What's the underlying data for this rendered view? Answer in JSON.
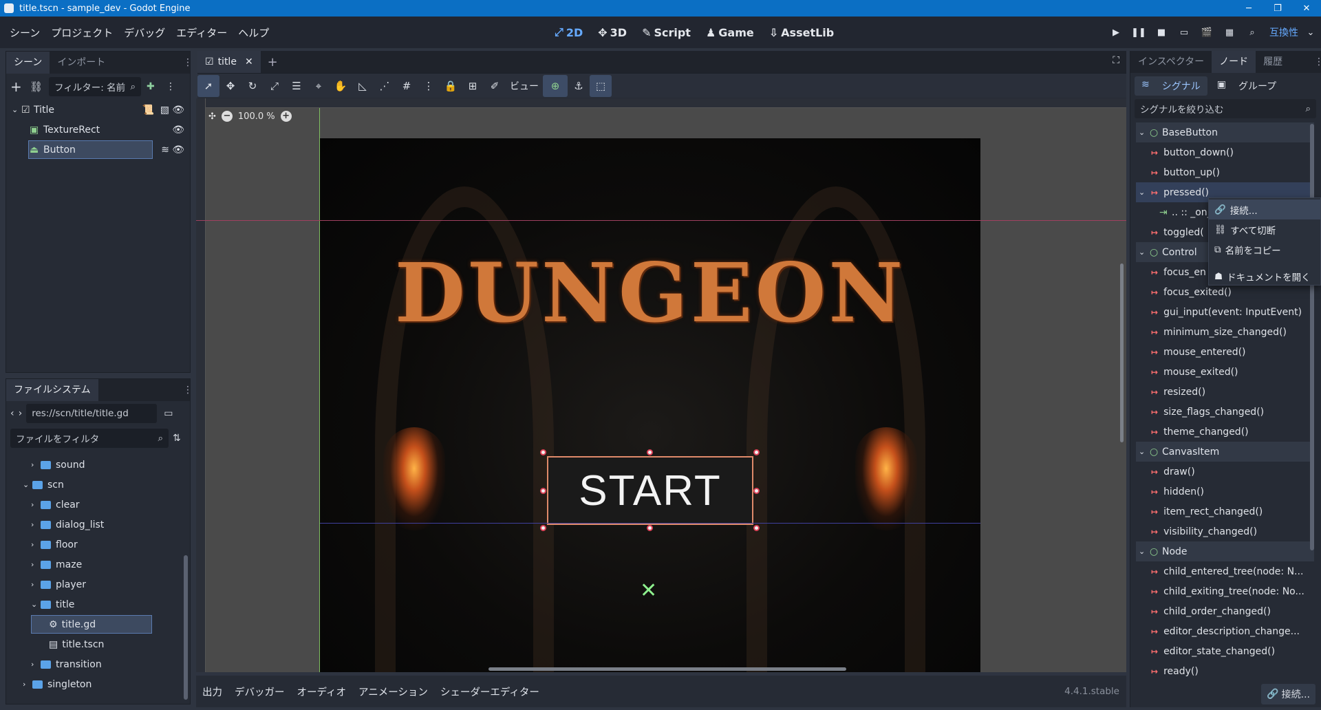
{
  "window": {
    "title": "title.tscn - sample_dev - Godot Engine",
    "min": "─",
    "max": "❐",
    "close": "✕"
  },
  "menu": [
    "シーン",
    "プロジェクト",
    "デバッグ",
    "エディター",
    "ヘルプ"
  ],
  "modes": [
    {
      "label": "2D",
      "icon": "⤢"
    },
    {
      "label": "3D",
      "icon": "✥"
    },
    {
      "label": "Script",
      "icon": "✎"
    },
    {
      "label": "Game",
      "icon": "♟"
    },
    {
      "label": "AssetLib",
      "icon": "⇩"
    }
  ],
  "compat": "互換性",
  "scene_panel": {
    "tabs": [
      "シーン",
      "インポート"
    ],
    "filter_placeholder": "フィルター: 名前",
    "nodes": [
      {
        "name": "Title",
        "icon": "control-node-icon"
      },
      {
        "name": "TextureRect",
        "icon": "texture-rect-icon"
      },
      {
        "name": "Button",
        "icon": "button-node-icon"
      }
    ]
  },
  "filesystem": {
    "tab": "ファイルシステム",
    "path": "res://scn/title/title.gd",
    "filter_placeholder": "ファイルをフィルタ",
    "items": [
      {
        "label": "sound",
        "indent": 1,
        "type": "folder",
        "open": false
      },
      {
        "label": "scn",
        "indent": 0,
        "type": "folder",
        "open": true
      },
      {
        "label": "clear",
        "indent": 1,
        "type": "folder",
        "open": false
      },
      {
        "label": "dialog_list",
        "indent": 1,
        "type": "folder",
        "open": false
      },
      {
        "label": "floor",
        "indent": 1,
        "type": "folder",
        "open": false
      },
      {
        "label": "maze",
        "indent": 1,
        "type": "folder",
        "open": false
      },
      {
        "label": "player",
        "indent": 1,
        "type": "folder",
        "open": false
      },
      {
        "label": "title",
        "indent": 1,
        "type": "folder",
        "open": true
      },
      {
        "label": "title.gd",
        "indent": 2,
        "type": "script",
        "selected": true
      },
      {
        "label": "title.tscn",
        "indent": 2,
        "type": "scene"
      },
      {
        "label": "transition",
        "indent": 1,
        "type": "folder",
        "open": false
      },
      {
        "label": "singleton",
        "indent": 0,
        "type": "folder",
        "open": false
      }
    ]
  },
  "editor": {
    "tab": "title",
    "view_label": "ビュー",
    "zoom": "100.0 %",
    "game_title": "DUNGEON",
    "start_label": "START"
  },
  "bottom_tabs": [
    "出力",
    "デバッガー",
    "オーディオ",
    "アニメーション",
    "シェーダーエディター"
  ],
  "version": "4.4.1.stable",
  "inspector": {
    "tabs": [
      "インスペクター",
      "ノード",
      "履歴"
    ],
    "subtabs": [
      "シグナル",
      "グループ"
    ],
    "filter_placeholder": "シグナルを絞り込む",
    "signals": [
      {
        "label": "BaseButton",
        "kind": "category"
      },
      {
        "label": "button_down()",
        "kind": "signal"
      },
      {
        "label": "button_up()",
        "kind": "signal"
      },
      {
        "label": "pressed()",
        "kind": "signal",
        "selected": true
      },
      {
        "label": ".. :: _on_",
        "kind": "connection"
      },
      {
        "label": "toggled(",
        "kind": "signal"
      },
      {
        "label": "Control",
        "kind": "category"
      },
      {
        "label": "focus_en",
        "kind": "signal"
      },
      {
        "label": "focus_exited()",
        "kind": "signal"
      },
      {
        "label": "gui_input(event: InputEvent)",
        "kind": "signal"
      },
      {
        "label": "minimum_size_changed()",
        "kind": "signal"
      },
      {
        "label": "mouse_entered()",
        "kind": "signal"
      },
      {
        "label": "mouse_exited()",
        "kind": "signal"
      },
      {
        "label": "resized()",
        "kind": "signal"
      },
      {
        "label": "size_flags_changed()",
        "kind": "signal"
      },
      {
        "label": "theme_changed()",
        "kind": "signal"
      },
      {
        "label": "CanvasItem",
        "kind": "category"
      },
      {
        "label": "draw()",
        "kind": "signal"
      },
      {
        "label": "hidden()",
        "kind": "signal"
      },
      {
        "label": "item_rect_changed()",
        "kind": "signal"
      },
      {
        "label": "visibility_changed()",
        "kind": "signal"
      },
      {
        "label": "Node",
        "kind": "category"
      },
      {
        "label": "child_entered_tree(node: N...",
        "kind": "signal"
      },
      {
        "label": "child_exiting_tree(node: No...",
        "kind": "signal"
      },
      {
        "label": "child_order_changed()",
        "kind": "signal"
      },
      {
        "label": "editor_description_change...",
        "kind": "signal"
      },
      {
        "label": "editor_state_changed()",
        "kind": "signal"
      },
      {
        "label": "ready()",
        "kind": "signal"
      }
    ],
    "connect_button": "接続..."
  },
  "context_menu": [
    "接続...",
    "すべて切断",
    "名前をコピー",
    "ドキュメントを開く"
  ],
  "colors": {
    "accent": "#66aaff",
    "titlebar": "#0b6fc4",
    "signal": "#ff6f6f",
    "panel": "#262b35"
  }
}
